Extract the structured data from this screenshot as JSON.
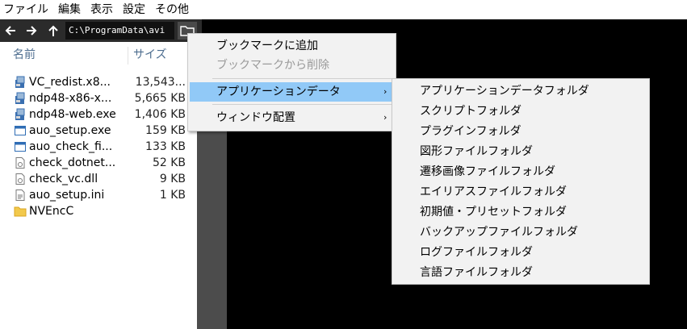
{
  "menubar": {
    "items": [
      "ファイル",
      "編集",
      "表示",
      "設定",
      "その他"
    ]
  },
  "navbar": {
    "back_icon": "arrow-left-icon",
    "forward_icon": "arrow-right-icon",
    "up_icon": "arrow-up-icon",
    "path": "C:\\ProgramData\\avi",
    "folder_icon": "folder-icon"
  },
  "filelist": {
    "columns": {
      "name": "名前",
      "size": "サイズ"
    },
    "rows": [
      {
        "name": "VC_redist.x8...",
        "size": "13,543...",
        "icon": "exe-installer-icon"
      },
      {
        "name": "ndp48-x86-x...",
        "size": "5,665 KB",
        "icon": "exe-installer-icon"
      },
      {
        "name": "ndp48-web.exe",
        "size": "1,406 KB",
        "icon": "exe-installer-icon"
      },
      {
        "name": "auo_setup.exe",
        "size": "159 KB",
        "icon": "exe-window-icon"
      },
      {
        "name": "auo_check_fi...",
        "size": "133 KB",
        "icon": "exe-window-icon"
      },
      {
        "name": "check_dotnet...",
        "size": "52 KB",
        "icon": "dll-file-icon"
      },
      {
        "name": "check_vc.dll",
        "size": "9 KB",
        "icon": "dll-file-icon"
      },
      {
        "name": "auo_setup.ini",
        "size": "1 KB",
        "icon": "ini-file-icon"
      },
      {
        "name": "NVEncC",
        "size": "",
        "icon": "folder-icon"
      }
    ]
  },
  "context_menu": {
    "add_bookmark": "ブックマークに追加",
    "remove_bookmark": "ブックマークから削除",
    "app_data": "アプリケーションデータ",
    "window_layout": "ウィンドウ配置",
    "submenu_arrow": "›"
  },
  "submenu": {
    "items": [
      "アプリケーションデータフォルダ",
      "スクリプトフォルダ",
      "プラグインフォルダ",
      "図形ファイルフォルダ",
      "遷移画像ファイルフォルダ",
      "エイリアスファイルフォルダ",
      "初期値・プリセットフォルダ",
      "バックアップファイルフォルダ",
      "ログファイルフォルダ",
      "言語ファイルフォルダ"
    ]
  },
  "colors": {
    "menu_highlight": "#91c9f7",
    "column_header": "#4d6d8f",
    "nav_bg": "#2b2b2b",
    "divider": "#4c4c4c"
  }
}
